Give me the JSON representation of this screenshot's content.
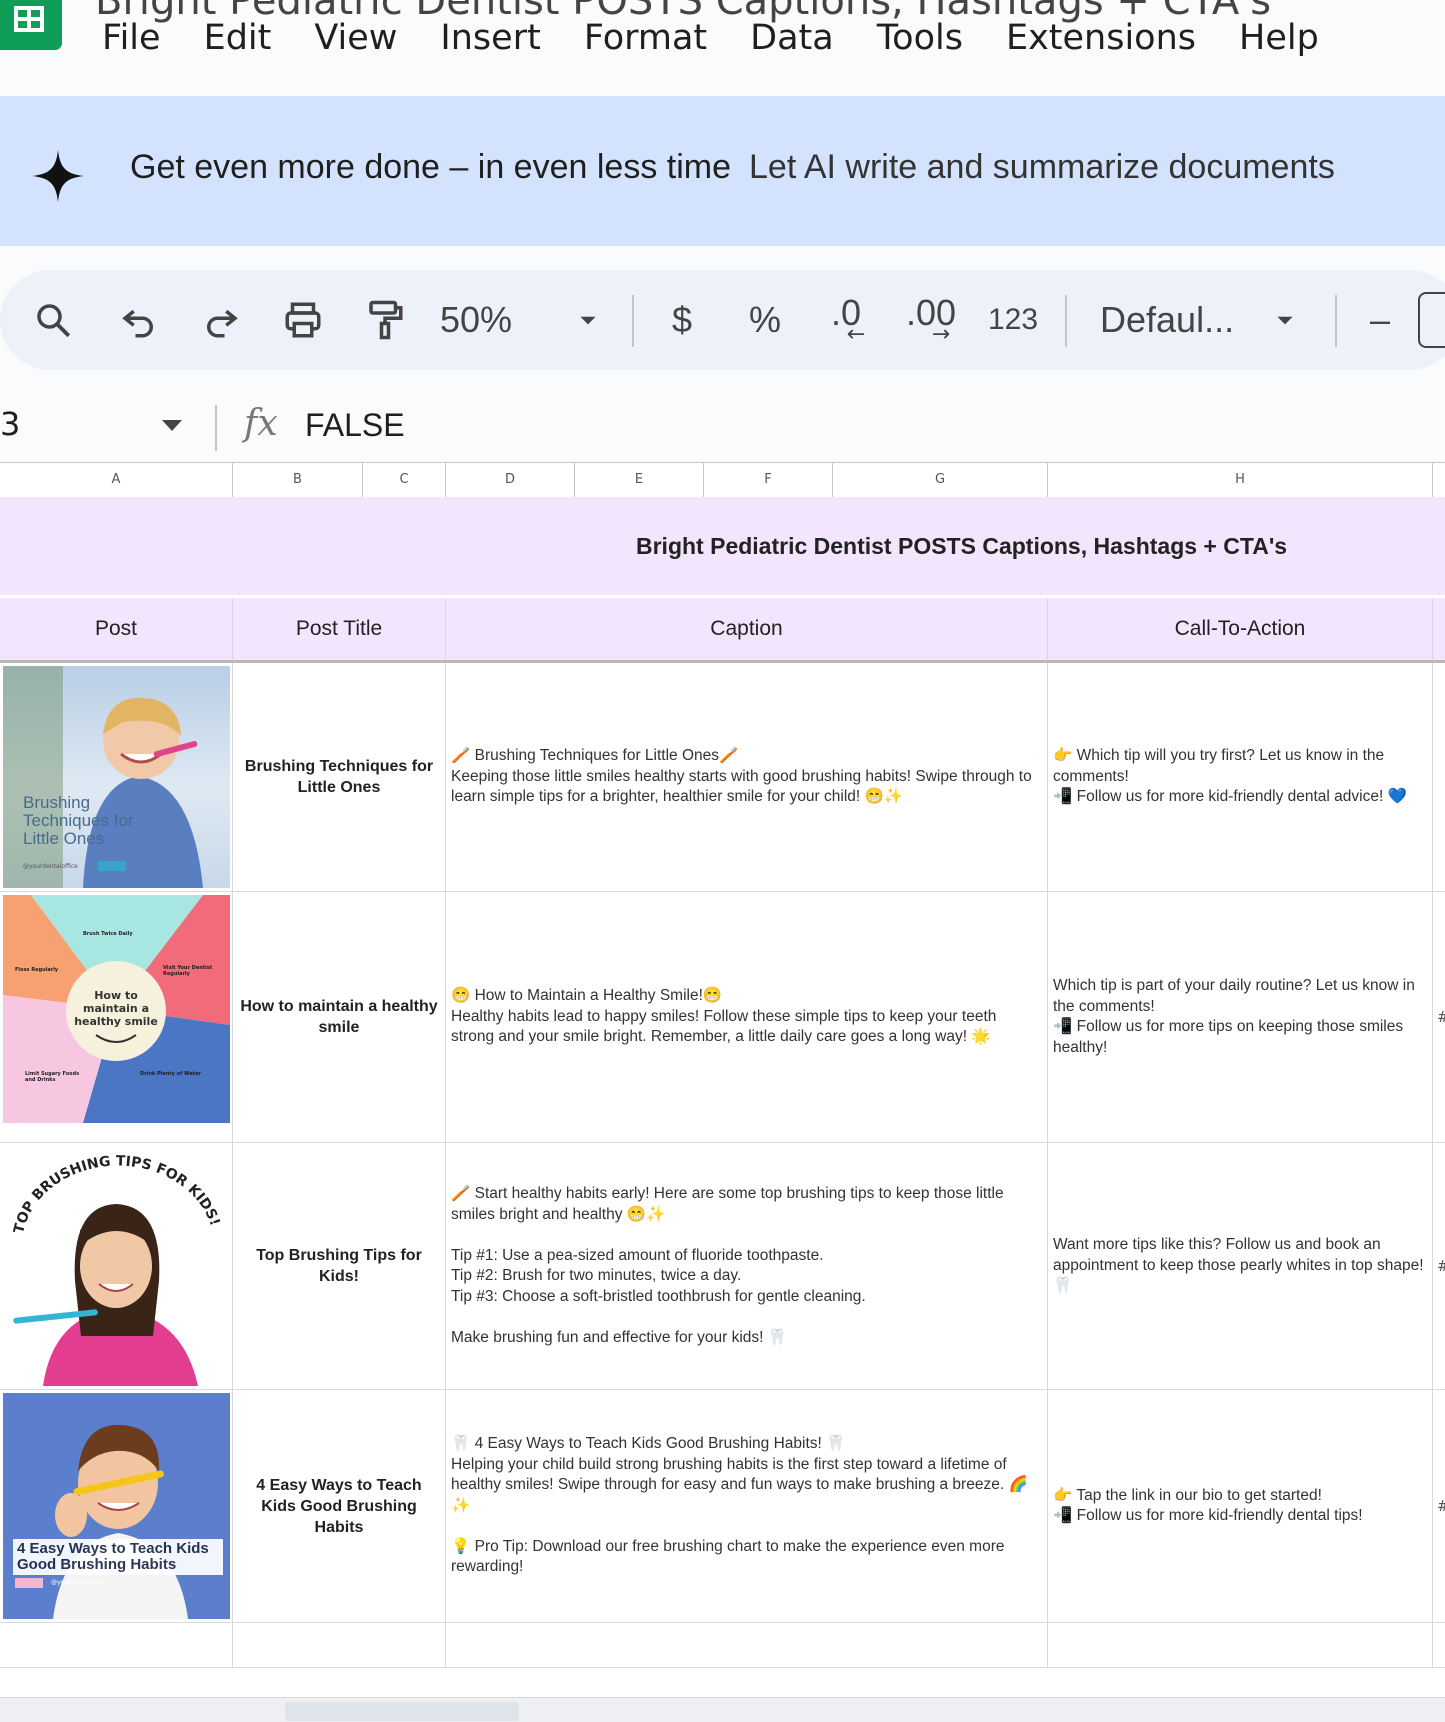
{
  "app": {
    "doc_title": "Bright Pediatric Dentist POSTS Captions, Hashtags + CTA's",
    "menu": [
      "File",
      "Edit",
      "View",
      "Insert",
      "Format",
      "Data",
      "Tools",
      "Extensions",
      "Help"
    ]
  },
  "banner": {
    "headline": "Get even more done – in even less time",
    "subtext": "Let AI write and summarize documents"
  },
  "toolbar": {
    "zoom": "50%",
    "currency": "$",
    "percent": "%",
    "dec_decrease": ".0",
    "dec_increase": ".00",
    "number_format": "123",
    "font": "Defaul...",
    "font_size_minus": "–"
  },
  "formula_bar": {
    "cell_ref": "3",
    "fx": "fx",
    "value": "FALSE"
  },
  "columns": [
    "A",
    "B",
    "C",
    "D",
    "E",
    "F",
    "G",
    "H"
  ],
  "sheet": {
    "title": "Bright Pediatric Dentist POSTS Captions, Hashtags + CTA's",
    "headers": {
      "post": "Post",
      "post_title": "Post Title",
      "caption": "Caption",
      "cta": "Call-To-Action"
    },
    "rows": [
      {
        "thumb_text": "Brushing Techniques for Little Ones",
        "thumb_sub": "@yourdentaloffice",
        "title": "Brushing Techniques for Little Ones",
        "caption": "🪥 Brushing Techniques for Little Ones🪥\nKeeping those little smiles healthy starts with good brushing habits! Swipe through to learn simple tips for a brighter, healthier smile for your child! 😁✨",
        "cta": "👉 Which tip will you try first? Let us know in the comments!\n📲 Follow us for more kid-friendly dental advice! 💙",
        "edge": ""
      },
      {
        "thumb_text": "How to maintain a healthy smile",
        "thumb_labels": [
          "Brush Twice Daily",
          "Floss Regularly",
          "Visit Your Dentist Regularly",
          "Limit Sugary Foods and Drinks",
          "Drink Plenty of Water"
        ],
        "title": "How to maintain a healthy smile",
        "caption": "😁 How to Maintain a Healthy Smile!😁\nHealthy habits lead to happy smiles! Follow these simple tips to keep your teeth strong and your smile bright. Remember, a little daily care goes a long way! 🌟",
        "cta": "Which tip is part of your daily routine? Let us know in the comments!\n📲 Follow us for more tips on keeping those smiles healthy!",
        "edge": "#"
      },
      {
        "thumb_text": "TOP BRUSHING TIPS FOR KIDS!",
        "title": "Top Brushing Tips for Kids!",
        "caption": "🪥 Start healthy habits early! Here are some top brushing tips to keep those little smiles bright and healthy 😁✨\n\nTip #1: Use a pea-sized amount of fluoride toothpaste.\nTip #2: Brush for two minutes, twice a day.\nTip #3: Choose a soft-bristled toothbrush for gentle cleaning.\n\nMake brushing fun and effective for your kids! 🦷",
        "cta": "Want more tips like this? Follow us and book an appointment to keep those pearly whites in top shape! 🦷",
        "edge": "#"
      },
      {
        "thumb_text": "4 Easy Ways to Teach Kids Good Brushing Habits",
        "thumb_sub": "@yourdentaloffice",
        "title": "4 Easy Ways to Teach Kids Good Brushing Habits",
        "caption": "🦷 4 Easy Ways to Teach Kids Good Brushing Habits! 🦷\nHelping your child build strong brushing habits is the first step toward a lifetime of healthy smiles! Swipe through for easy and fun ways to make brushing a breeze. 🌈✨\n\n💡 Pro Tip: Download our free brushing chart to make the experience even more rewarding!",
        "cta": "👉 Tap the link in our bio to get started!\n📲 Follow us for more kid-friendly dental tips!",
        "edge": "#"
      }
    ]
  },
  "colors": {
    "banner": "#d3e3fd",
    "toolbar": "#edf2fa",
    "header_fill": "#f3e5fd",
    "sheets_green": "#0f9d58"
  }
}
